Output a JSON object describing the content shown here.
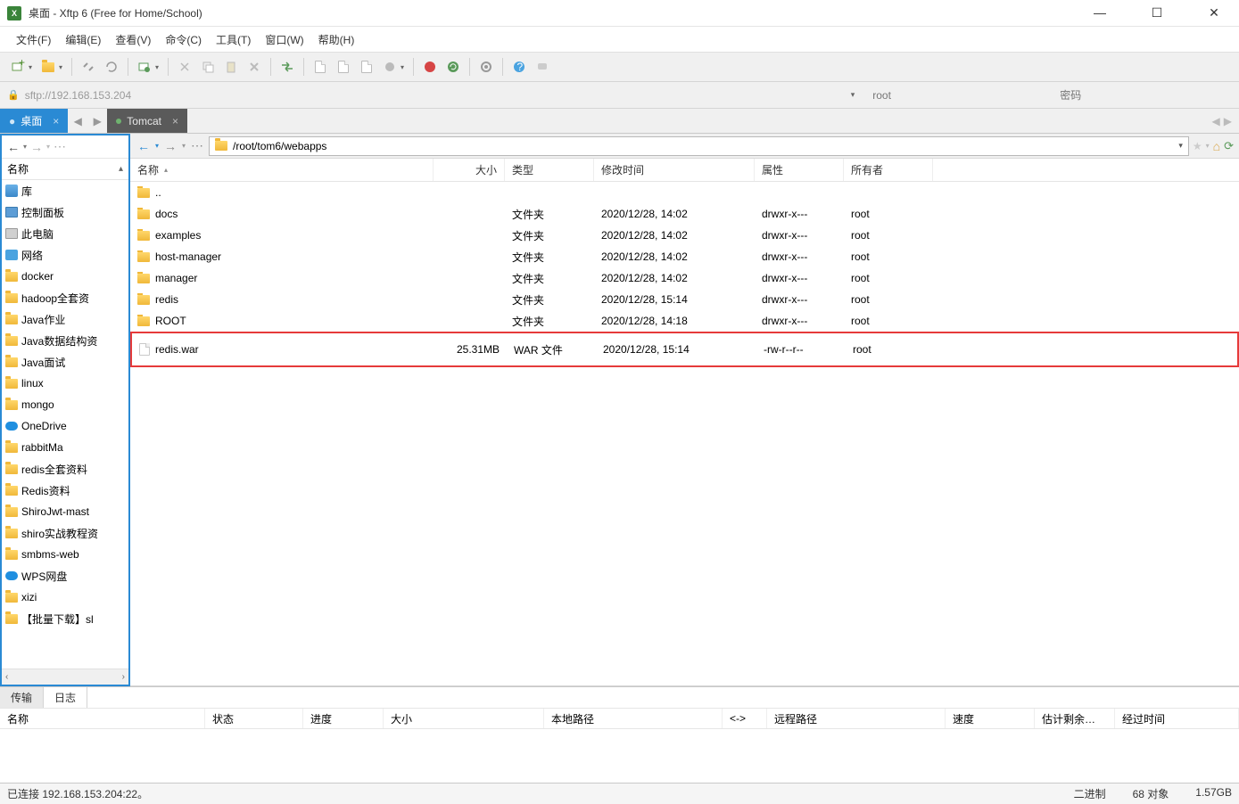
{
  "window": {
    "title": "桌面 - Xftp 6 (Free for Home/School)"
  },
  "menu": {
    "file": "文件(F)",
    "edit": "编辑(E)",
    "view": "查看(V)",
    "command": "命令(C)",
    "tool": "工具(T)",
    "window": "窗口(W)",
    "help": "帮助(H)"
  },
  "address": {
    "url": "sftp://192.168.153.204",
    "user_placeholder": "root",
    "user_value": "root",
    "pass_placeholder": "密码"
  },
  "tabs": {
    "left": "桌面",
    "right": "Tomcat"
  },
  "leftpane": {
    "name_header": "名称",
    "items": [
      {
        "label": "库",
        "icon": "lib"
      },
      {
        "label": "控制面板",
        "icon": "cp"
      },
      {
        "label": "此电脑",
        "icon": "pc"
      },
      {
        "label": "网络",
        "icon": "net"
      },
      {
        "label": "docker",
        "icon": "folder"
      },
      {
        "label": "hadoop全套资",
        "icon": "folder"
      },
      {
        "label": "Java作业",
        "icon": "folder"
      },
      {
        "label": "Java数据结构资",
        "icon": "folder"
      },
      {
        "label": "Java面试",
        "icon": "folder"
      },
      {
        "label": "linux",
        "icon": "folder"
      },
      {
        "label": "mongo",
        "icon": "folder"
      },
      {
        "label": "OneDrive",
        "icon": "cloud"
      },
      {
        "label": "rabbitMa",
        "icon": "folder"
      },
      {
        "label": "redis全套资料",
        "icon": "folder"
      },
      {
        "label": "Redis资料",
        "icon": "folder"
      },
      {
        "label": "ShiroJwt-mast",
        "icon": "folder"
      },
      {
        "label": "shiro实战教程资",
        "icon": "folder"
      },
      {
        "label": "smbms-web",
        "icon": "folder"
      },
      {
        "label": "WPS网盘",
        "icon": "cloud"
      },
      {
        "label": "xizi",
        "icon": "folder"
      },
      {
        "label": "【批量下载】sl",
        "icon": "folder"
      }
    ]
  },
  "rightpane": {
    "path": "/root/tom6/webapps",
    "columns": {
      "name": "名称",
      "size": "大小",
      "type": "类型",
      "date": "修改时间",
      "attr": "属性",
      "owner": "所有者"
    },
    "rows": [
      {
        "name": "..",
        "icon": "folder",
        "size": "",
        "type": "",
        "date": "",
        "attr": "",
        "owner": ""
      },
      {
        "name": "docs",
        "icon": "folder",
        "size": "",
        "type": "文件夹",
        "date": "2020/12/28, 14:02",
        "attr": "drwxr-x---",
        "owner": "root"
      },
      {
        "name": "examples",
        "icon": "folder",
        "size": "",
        "type": "文件夹",
        "date": "2020/12/28, 14:02",
        "attr": "drwxr-x---",
        "owner": "root"
      },
      {
        "name": "host-manager",
        "icon": "folder",
        "size": "",
        "type": "文件夹",
        "date": "2020/12/28, 14:02",
        "attr": "drwxr-x---",
        "owner": "root"
      },
      {
        "name": "manager",
        "icon": "folder",
        "size": "",
        "type": "文件夹",
        "date": "2020/12/28, 14:02",
        "attr": "drwxr-x---",
        "owner": "root"
      },
      {
        "name": "redis",
        "icon": "folder",
        "size": "",
        "type": "文件夹",
        "date": "2020/12/28, 15:14",
        "attr": "drwxr-x---",
        "owner": "root"
      },
      {
        "name": "ROOT",
        "icon": "folder",
        "size": "",
        "type": "文件夹",
        "date": "2020/12/28, 14:18",
        "attr": "drwxr-x---",
        "owner": "root"
      },
      {
        "name": "redis.war",
        "icon": "file",
        "size": "25.31MB",
        "type": "WAR 文件",
        "date": "2020/12/28, 15:14",
        "attr": "-rw-r--r--",
        "owner": "root",
        "highlight": true
      }
    ]
  },
  "logtabs": {
    "transfer": "传输",
    "log": "日志"
  },
  "xfer_columns": {
    "name": "名称",
    "status": "状态",
    "progress": "进度",
    "size": "大小",
    "local": "本地路径",
    "arrow": "<->",
    "remote": "远程路径",
    "speed": "速度",
    "eta": "估计剩余…",
    "elapsed": "经过时间"
  },
  "status": {
    "left": "已连接 192.168.153.204:22。",
    "binary": "二进制",
    "objects": "68 对象",
    "size": "1.57GB"
  }
}
